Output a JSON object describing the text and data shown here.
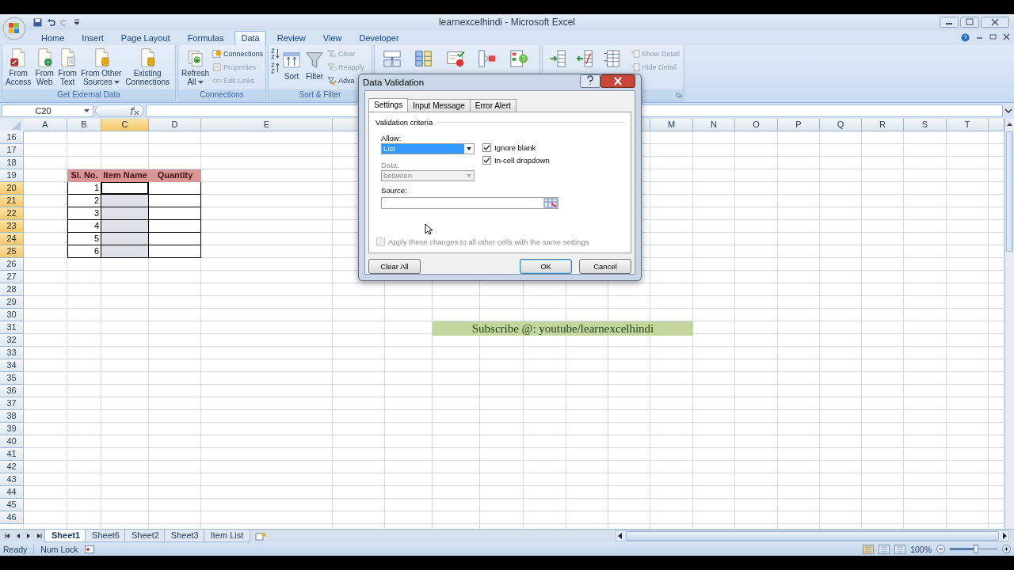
{
  "window": {
    "title": "learnexcelhindi - Microsoft Excel"
  },
  "ribbon_tabs": [
    {
      "label": "Home",
      "selected": false
    },
    {
      "label": "Insert",
      "selected": false
    },
    {
      "label": "Page Layout",
      "selected": false
    },
    {
      "label": "Formulas",
      "selected": false
    },
    {
      "label": "Data",
      "selected": true
    },
    {
      "label": "Review",
      "selected": false
    },
    {
      "label": "View",
      "selected": false
    },
    {
      "label": "Developer",
      "selected": false
    }
  ],
  "ribbon": {
    "groups": [
      {
        "label": "Get External Data",
        "items": [
          {
            "kind": "large",
            "label": "From\nAccess",
            "menu": false
          },
          {
            "kind": "large",
            "label": "From\nWeb",
            "menu": false
          },
          {
            "kind": "large",
            "label": "From\nText",
            "menu": false
          },
          {
            "kind": "large",
            "label": "From Other\nSources",
            "menu": true
          },
          {
            "kind": "large",
            "label": "Existing\nConnections",
            "menu": false
          }
        ]
      },
      {
        "label": "Connections",
        "items": [
          {
            "kind": "large",
            "label": "Refresh\nAll",
            "menu": true
          },
          {
            "kind": "column",
            "items": [
              {
                "label": "Connections",
                "disabled": false
              },
              {
                "label": "Properties",
                "disabled": true
              },
              {
                "label": "Edit Links",
                "disabled": true
              }
            ]
          }
        ]
      },
      {
        "label": "Sort & Filter",
        "items": [
          {
            "kind": "column",
            "items": [
              {
                "disabled": false
              },
              {
                "disabled": false
              }
            ]
          },
          {
            "kind": "large",
            "label": "Sort",
            "menu": false
          },
          {
            "kind": "large",
            "label": "Filter",
            "menu": false
          },
          {
            "kind": "column",
            "items": [
              {
                "label": "Clear",
                "disabled": true
              },
              {
                "label": "Reapply",
                "disabled": true
              },
              {
                "label": "Adva",
                "disabled": false
              }
            ]
          }
        ]
      },
      {
        "items": [
          {
            "kind": "large"
          },
          {
            "kind": "large"
          },
          {
            "kind": "large"
          },
          {
            "kind": "large"
          },
          {
            "kind": "large"
          }
        ]
      },
      {
        "launcher": true,
        "items": [
          {
            "kind": "large"
          },
          {
            "kind": "large"
          },
          {
            "kind": "large"
          },
          {
            "kind": "column",
            "items": [
              {
                "label": "Show Detail",
                "disabled": true
              },
              {
                "label": "Hide Detail",
                "disabled": true
              }
            ]
          }
        ]
      }
    ]
  },
  "formula_bar": {
    "name_box": "C20"
  },
  "columns_left": [
    {
      "label": "A",
      "selected": false
    },
    {
      "label": "B",
      "selected": false
    },
    {
      "label": "C",
      "selected": true
    },
    {
      "label": "D",
      "selected": false
    },
    {
      "label": "E",
      "selected": false
    }
  ],
  "columns_right": [
    {
      "label": "M",
      "selected": false
    },
    {
      "label": "N",
      "selected": false
    },
    {
      "label": "O",
      "selected": false
    },
    {
      "label": "P",
      "selected": false
    },
    {
      "label": "Q",
      "selected": false
    },
    {
      "label": "R",
      "selected": false
    },
    {
      "label": "S",
      "selected": false
    },
    {
      "label": "T",
      "selected": false
    }
  ],
  "rows": [
    {
      "label": "16",
      "selected": false
    },
    {
      "label": "17",
      "selected": false
    },
    {
      "label": "18",
      "selected": false
    },
    {
      "label": "19",
      "selected": false
    },
    {
      "label": "20",
      "selected": true
    },
    {
      "label": "21",
      "selected": true
    },
    {
      "label": "22",
      "selected": true
    },
    {
      "label": "23",
      "selected": true
    },
    {
      "label": "24",
      "selected": true
    },
    {
      "label": "25",
      "selected": true
    },
    {
      "label": "26",
      "selected": false
    },
    {
      "label": "27",
      "selected": false
    },
    {
      "label": "28",
      "selected": false
    },
    {
      "label": "29",
      "selected": false
    },
    {
      "label": "30",
      "selected": false
    },
    {
      "label": "31",
      "selected": false
    },
    {
      "label": "32",
      "selected": false
    },
    {
      "label": "33",
      "selected": false
    },
    {
      "label": "34",
      "selected": false
    },
    {
      "label": "35",
      "selected": false
    },
    {
      "label": "36",
      "selected": false
    },
    {
      "label": "37",
      "selected": false
    },
    {
      "label": "38",
      "selected": false
    },
    {
      "label": "39",
      "selected": false
    },
    {
      "label": "40",
      "selected": false
    },
    {
      "label": "41",
      "selected": false
    },
    {
      "label": "42",
      "selected": false
    },
    {
      "label": "43",
      "selected": false
    },
    {
      "label": "44",
      "selected": false
    },
    {
      "label": "45",
      "selected": false
    },
    {
      "label": "46",
      "selected": false
    }
  ],
  "table": {
    "headers": [
      "Sl. No.",
      "Item Name",
      "Quantity"
    ],
    "rows": [
      {
        "sl_no": "1",
        "item_selected": true,
        "item_active": true
      },
      {
        "sl_no": "2",
        "item_selected": true,
        "item_active": false
      },
      {
        "sl_no": "3",
        "item_selected": true,
        "item_active": false
      },
      {
        "sl_no": "4",
        "item_selected": true,
        "item_active": false
      },
      {
        "sl_no": "5",
        "item_selected": true,
        "item_active": false
      },
      {
        "sl_no": "6",
        "item_selected": true,
        "item_active": false
      }
    ]
  },
  "banner": "Subscribe @: youtube/learnexcelhindi",
  "sheet_tabs": [
    {
      "label": "Sheet1",
      "selected": true
    },
    {
      "label": "Sheet6",
      "selected": false
    },
    {
      "label": "Sheet2",
      "selected": false
    },
    {
      "label": "Sheet3",
      "selected": false
    },
    {
      "label": "Item List",
      "selected": false
    }
  ],
  "status_bar": {
    "items": [
      "Ready",
      "Num Lock"
    ],
    "zoom": "100%",
    "zoom_level": {
      "level": 0.55
    }
  },
  "dialog": {
    "title": "Data Validation",
    "tabs": [
      {
        "label": "Settings",
        "selected": true
      },
      {
        "label": "Input Message",
        "selected": false
      },
      {
        "label": "Error Alert",
        "selected": false
      }
    ],
    "group_label": "Validation criteria",
    "allow": {
      "label": "Allow:",
      "value": "List",
      "disabled": false
    },
    "options": [
      {
        "label": "Ignore blank",
        "checked": true,
        "disabled": false
      },
      {
        "label": "In-cell dropdown",
        "checked": true,
        "disabled": false
      }
    ],
    "data": {
      "label": "Data:",
      "value": "between",
      "disabled": true
    },
    "source": {
      "label": "Source:"
    },
    "apply_all": {
      "label": "Apply these changes to all other cells with the same settings",
      "checked": false,
      "disabled": true
    },
    "buttons": [
      {
        "label": "Clear All",
        "default": false
      },
      {
        "label": "OK",
        "default": true
      },
      {
        "label": "Cancel",
        "default": false
      }
    ]
  }
}
